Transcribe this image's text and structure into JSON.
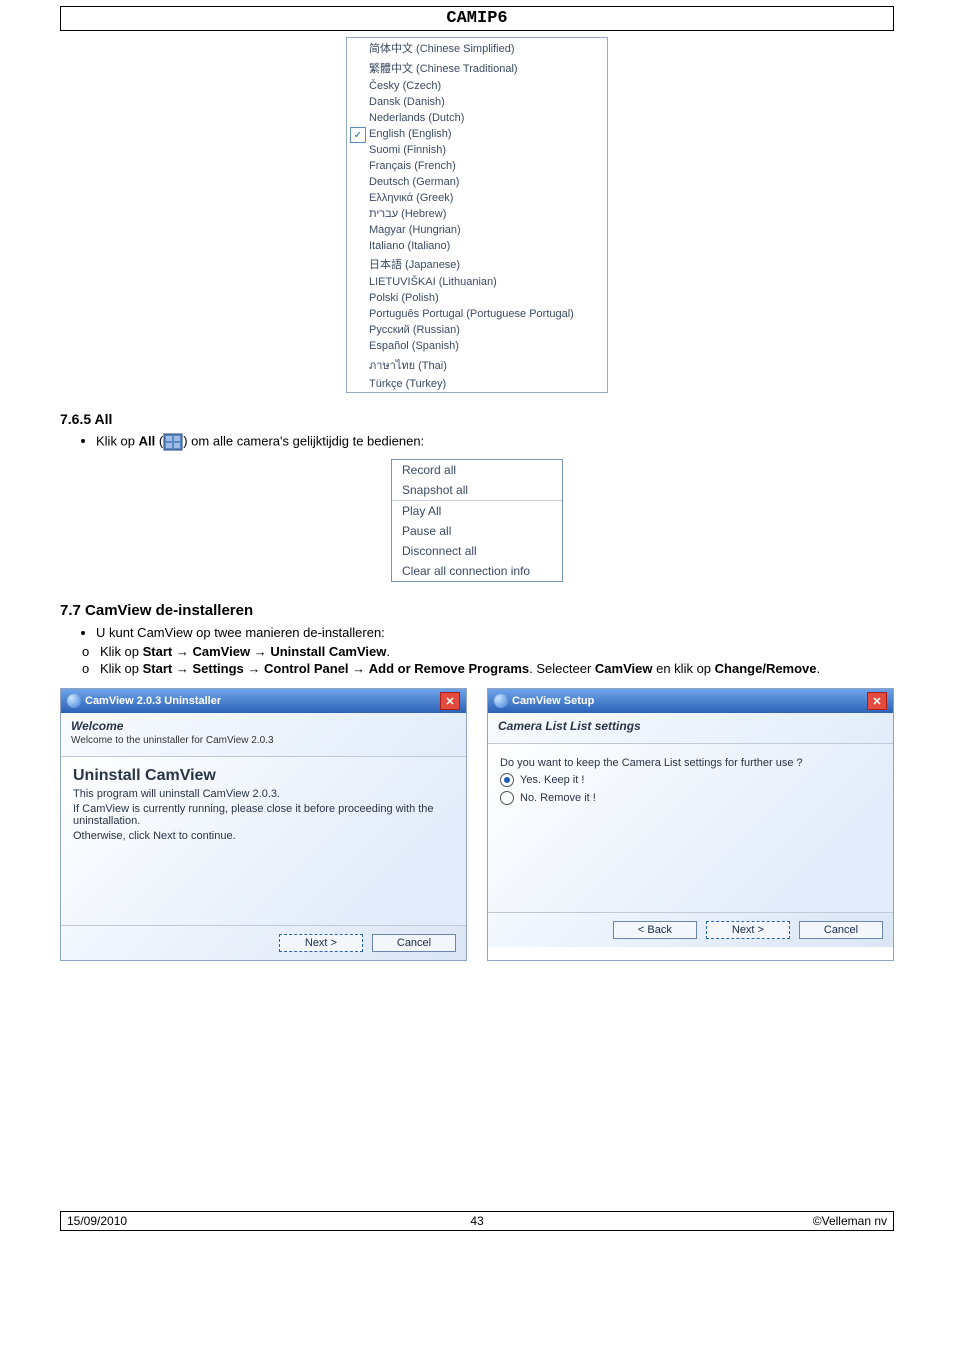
{
  "header": {
    "title": "CAMIP6"
  },
  "languages": {
    "selectedIndex": 5,
    "items": [
      "简体中文 (Chinese Simplified)",
      "繁體中文 (Chinese Traditional)",
      "Česky (Czech)",
      "Dansk (Danish)",
      "Nederlands (Dutch)",
      "English (English)",
      "Suomi (Finnish)",
      "Français (French)",
      "Deutsch (German)",
      "Ελληνικά (Greek)",
      "עברית (Hebrew)",
      "Magyar (Hungrian)",
      "Italiano (Italiano)",
      "日本語 (Japanese)",
      "LIETUVIŠKAI (Lithuanian)",
      "Polski (Polish)",
      "Português Portugal (Portuguese Portugal)",
      "Русский (Russian)",
      "Español (Spanish)",
      "ภาษาไทย (Thai)",
      "Türkçe (Turkey)"
    ]
  },
  "section_all": {
    "heading": "7.6.5 All",
    "text_before": "Klik op ",
    "bold_word": "All",
    "text_after": " om alle camera's gelijktijdig te bedienen:"
  },
  "all_menu": {
    "items": [
      "Record all",
      "Snapshot all",
      "Play All",
      "Pause all",
      "Disconnect all",
      "Clear all connection info"
    ],
    "sep_after_index": 1
  },
  "section_deinstall": {
    "heading": "7.7 CamView de-installeren",
    "intro": "U kunt CamView op twee manieren de-installeren:",
    "line1": {
      "p0": "Klik op ",
      "b0": "Start",
      "a0": " → ",
      "b1": "CamView",
      "a1": " → ",
      "b2": "Uninstall CamView",
      "a2": "."
    },
    "line2": {
      "p0": "Klik op ",
      "b0": "Start",
      "a0": " → ",
      "b1": "Settings",
      "a1": " → ",
      "b2": "Control Panel",
      "a2": " → ",
      "b3": "Add or Remove Programs",
      "a3": ". Selecteer ",
      "b4": "CamView",
      "a4": " en klik op ",
      "b5": "Change/Remove",
      "a5": "."
    }
  },
  "dialog1": {
    "title": "CamView 2.0.3 Uninstaller",
    "head_title": "Welcome",
    "head_sub": "Welcome to the uninstaller for CamView 2.0.3",
    "body_title": "Uninstall CamView",
    "body_p1": "This program will uninstall CamView 2.0.3.",
    "body_p2": "If CamView is currently running, please close it before proceeding with the uninstallation.",
    "body_p3": "Otherwise, click Next to continue.",
    "btn_next": "Next >",
    "btn_cancel": "Cancel"
  },
  "dialog2": {
    "title": "CamView Setup",
    "head_title": "Camera List List settings",
    "body_q": "Do you want to keep the Camera List settings for further use ?",
    "opt_yes": "Yes. Keep it !",
    "opt_no": "No. Remove it !",
    "btn_back": "< Back",
    "btn_next": "Next >",
    "btn_cancel": "Cancel"
  },
  "footer": {
    "date": "15/09/2010",
    "page": "43",
    "copy": "©Velleman nv"
  }
}
